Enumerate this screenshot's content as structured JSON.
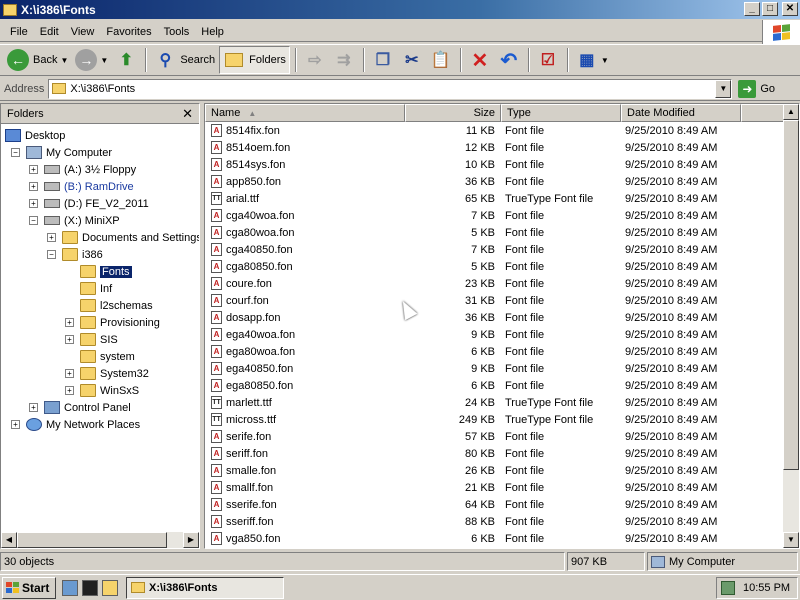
{
  "window": {
    "title": "X:\\i386\\Fonts",
    "min": "_",
    "max": "□",
    "close": "✕"
  },
  "menu": [
    "File",
    "Edit",
    "View",
    "Favorites",
    "Tools",
    "Help"
  ],
  "toolbar": {
    "back": "Back",
    "search": "Search",
    "folders": "Folders"
  },
  "address": {
    "label": "Address",
    "value": "X:\\i386\\Fonts",
    "go": "Go"
  },
  "folders_pane": {
    "title": "Folders",
    "close": "✕",
    "tree": [
      {
        "label": "Desktop",
        "icon": "desk",
        "level": 0,
        "expander": ""
      },
      {
        "label": "My Computer",
        "icon": "comp",
        "level": 1,
        "expander": "−"
      },
      {
        "label": "(A:) 3½ Floppy",
        "icon": "drive",
        "level": 2,
        "expander": "+"
      },
      {
        "label": "(B:) RamDrive",
        "icon": "drive",
        "level": 2,
        "expander": "+",
        "blue": true
      },
      {
        "label": "(D:) FE_V2_2011",
        "icon": "drive",
        "level": 2,
        "expander": "+"
      },
      {
        "label": "(X:) MiniXP",
        "icon": "drive",
        "level": 2,
        "expander": "−"
      },
      {
        "label": "Documents and Settings",
        "icon": "folder",
        "level": 3,
        "expander": "+"
      },
      {
        "label": "i386",
        "icon": "folder",
        "level": 3,
        "expander": "−"
      },
      {
        "label": "Fonts",
        "icon": "folder",
        "level": 4,
        "expander": "",
        "selected": true
      },
      {
        "label": "Inf",
        "icon": "folder",
        "level": 4,
        "expander": ""
      },
      {
        "label": "l2schemas",
        "icon": "folder",
        "level": 4,
        "expander": ""
      },
      {
        "label": "Provisioning",
        "icon": "folder",
        "level": 4,
        "expander": "+"
      },
      {
        "label": "SIS",
        "icon": "folder",
        "level": 4,
        "expander": "+"
      },
      {
        "label": "system",
        "icon": "folder",
        "level": 4,
        "expander": ""
      },
      {
        "label": "System32",
        "icon": "folder",
        "level": 4,
        "expander": "+"
      },
      {
        "label": "WinSxS",
        "icon": "folder",
        "level": 4,
        "expander": "+"
      },
      {
        "label": "Control Panel",
        "icon": "cp",
        "level": 2,
        "expander": "+"
      },
      {
        "label": "My Network Places",
        "icon": "net",
        "level": 1,
        "expander": "+"
      }
    ]
  },
  "columns": {
    "name": "Name",
    "size": "Size",
    "type": "Type",
    "date": "Date Modified"
  },
  "files": [
    {
      "name": "8514fix.fon",
      "size": "11 KB",
      "type": "Font file",
      "date": "9/25/2010 8:49 AM",
      "kind": "fon"
    },
    {
      "name": "8514oem.fon",
      "size": "12 KB",
      "type": "Font file",
      "date": "9/25/2010 8:49 AM",
      "kind": "fon"
    },
    {
      "name": "8514sys.fon",
      "size": "10 KB",
      "type": "Font file",
      "date": "9/25/2010 8:49 AM",
      "kind": "fon"
    },
    {
      "name": "app850.fon",
      "size": "36 KB",
      "type": "Font file",
      "date": "9/25/2010 8:49 AM",
      "kind": "fon"
    },
    {
      "name": "arial.ttf",
      "size": "65 KB",
      "type": "TrueType Font file",
      "date": "9/25/2010 8:49 AM",
      "kind": "ttf"
    },
    {
      "name": "cga40woa.fon",
      "size": "7 KB",
      "type": "Font file",
      "date": "9/25/2010 8:49 AM",
      "kind": "fon"
    },
    {
      "name": "cga80woa.fon",
      "size": "5 KB",
      "type": "Font file",
      "date": "9/25/2010 8:49 AM",
      "kind": "fon"
    },
    {
      "name": "cga40850.fon",
      "size": "7 KB",
      "type": "Font file",
      "date": "9/25/2010 8:49 AM",
      "kind": "fon"
    },
    {
      "name": "cga80850.fon",
      "size": "5 KB",
      "type": "Font file",
      "date": "9/25/2010 8:49 AM",
      "kind": "fon"
    },
    {
      "name": "coure.fon",
      "size": "23 KB",
      "type": "Font file",
      "date": "9/25/2010 8:49 AM",
      "kind": "fon"
    },
    {
      "name": "courf.fon",
      "size": "31 KB",
      "type": "Font file",
      "date": "9/25/2010 8:49 AM",
      "kind": "fon"
    },
    {
      "name": "dosapp.fon",
      "size": "36 KB",
      "type": "Font file",
      "date": "9/25/2010 8:49 AM",
      "kind": "fon"
    },
    {
      "name": "ega40woa.fon",
      "size": "9 KB",
      "type": "Font file",
      "date": "9/25/2010 8:49 AM",
      "kind": "fon"
    },
    {
      "name": "ega80woa.fon",
      "size": "6 KB",
      "type": "Font file",
      "date": "9/25/2010 8:49 AM",
      "kind": "fon"
    },
    {
      "name": "ega40850.fon",
      "size": "9 KB",
      "type": "Font file",
      "date": "9/25/2010 8:49 AM",
      "kind": "fon"
    },
    {
      "name": "ega80850.fon",
      "size": "6 KB",
      "type": "Font file",
      "date": "9/25/2010 8:49 AM",
      "kind": "fon"
    },
    {
      "name": "marlett.ttf",
      "size": "24 KB",
      "type": "TrueType Font file",
      "date": "9/25/2010 8:49 AM",
      "kind": "ttf"
    },
    {
      "name": "micross.ttf",
      "size": "249 KB",
      "type": "TrueType Font file",
      "date": "9/25/2010 8:49 AM",
      "kind": "ttf"
    },
    {
      "name": "serife.fon",
      "size": "57 KB",
      "type": "Font file",
      "date": "9/25/2010 8:49 AM",
      "kind": "fon"
    },
    {
      "name": "seriff.fon",
      "size": "80 KB",
      "type": "Font file",
      "date": "9/25/2010 8:49 AM",
      "kind": "fon"
    },
    {
      "name": "smalle.fon",
      "size": "26 KB",
      "type": "Font file",
      "date": "9/25/2010 8:49 AM",
      "kind": "fon"
    },
    {
      "name": "smallf.fon",
      "size": "21 KB",
      "type": "Font file",
      "date": "9/25/2010 8:49 AM",
      "kind": "fon"
    },
    {
      "name": "sserife.fon",
      "size": "64 KB",
      "type": "Font file",
      "date": "9/25/2010 8:49 AM",
      "kind": "fon"
    },
    {
      "name": "sseriff.fon",
      "size": "88 KB",
      "type": "Font file",
      "date": "9/25/2010 8:49 AM",
      "kind": "fon"
    },
    {
      "name": "vga850.fon",
      "size": "6 KB",
      "type": "Font file",
      "date": "9/25/2010 8:49 AM",
      "kind": "fon"
    }
  ],
  "status": {
    "objects": "30 objects",
    "size": "907 KB",
    "location": "My Computer"
  },
  "taskbar": {
    "start": "Start",
    "task": "X:\\i386\\Fonts",
    "clock": "10:55 PM"
  },
  "icons": {
    "back": "back-arrow-icon",
    "forward": "forward-arrow-icon",
    "up": "up-folder-icon",
    "search": "search-icon",
    "folders": "folders-icon",
    "delete": "delete-icon",
    "undo": "undo-icon"
  }
}
